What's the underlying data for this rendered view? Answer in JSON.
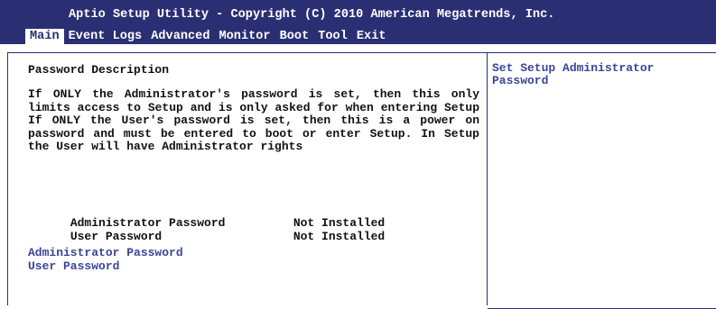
{
  "header": {
    "title": "Aptio Setup Utility - Copyright (C) 2010 American Megatrends, Inc.",
    "menu": [
      {
        "label": "Main",
        "active": true
      },
      {
        "label": "Event Logs",
        "active": false
      },
      {
        "label": "Advanced",
        "active": false
      },
      {
        "label": "Monitor",
        "active": false
      },
      {
        "label": "Boot",
        "active": false
      },
      {
        "label": "Tool",
        "active": false
      },
      {
        "label": "Exit",
        "active": false
      }
    ]
  },
  "main": {
    "description_heading": "Password Description",
    "description_body": "If ONLY the Administrator's password is set, then this only limits access to Setup and is only asked for when entering Setup If ONLY the User's password is set, then this is a power on password and must be entered to boot or enter Setup. In Setup the User will have Administrator rights",
    "status": [
      {
        "label": "Administrator Password",
        "value": "Not Installed"
      },
      {
        "label": "User Password",
        "value": "Not Installed"
      }
    ],
    "links": {
      "admin_password": "Administrator Password",
      "user_password": "User Password"
    }
  },
  "help": {
    "text": "Set Setup Administrator Password"
  },
  "colors": {
    "header_bg": "#2a2f74",
    "selectable_text": "#3a4598"
  }
}
